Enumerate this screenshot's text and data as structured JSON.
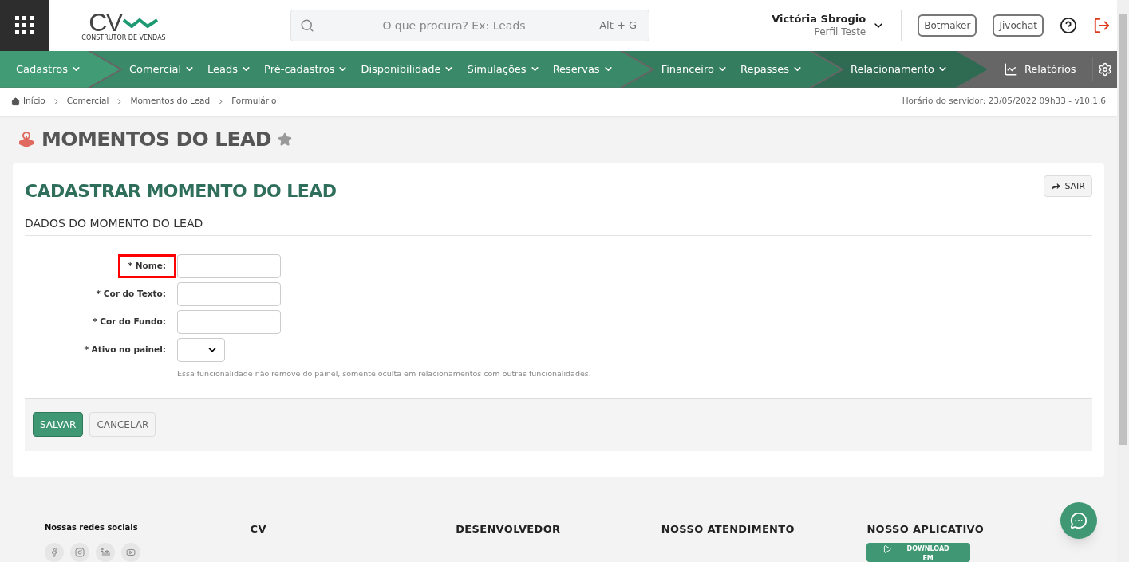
{
  "header": {
    "logo": {
      "mark": "CV",
      "tagline": "CONSTRUTOR DE VENDAS"
    },
    "search": {
      "placeholder": "O que procura? Ex: Leads",
      "shortcut": "Alt + G"
    },
    "user": {
      "name": "Victória Sbrogio",
      "profile": "Perfil Teste"
    },
    "buttons": [
      "Botmaker",
      "Jivochat"
    ]
  },
  "nav": {
    "groups": [
      {
        "items": [
          "Cadastros"
        ]
      },
      {
        "items": [
          "Comercial",
          "Leads",
          "Pré-cadastros",
          "Disponibilidade",
          "Simulações",
          "Reservas"
        ]
      },
      {
        "items": [
          "Financeiro",
          "Repasses"
        ]
      },
      {
        "items": [
          "Relacionamento"
        ]
      }
    ],
    "reports": "Relatórios"
  },
  "breadcrumb": {
    "items": [
      "Início",
      "Comercial",
      "Momentos do Lead",
      "Formulário"
    ],
    "server_time": "Horário do servidor: 23/05/2022 09h33 - v10.1.6"
  },
  "page": {
    "title": "MOMENTOS DO LEAD",
    "favorite": false
  },
  "card": {
    "title": "CADASTRAR MOMENTO DO LEAD",
    "exit_button": "SAIR",
    "section": "DADOS DO MOMENTO DO LEAD",
    "fields": [
      {
        "label": "* Nome:",
        "kind": "text",
        "highlighted": true
      },
      {
        "label": "* Cor do Texto:",
        "kind": "text",
        "highlighted": false
      },
      {
        "label": "* Cor do Fundo:",
        "kind": "text",
        "highlighted": false
      },
      {
        "label": "* Ativo no painel:",
        "kind": "select",
        "highlighted": false,
        "help": "Essa funcionalidade não remove do painel, somente oculta em relacionamentos com outras funcionalidades."
      }
    ],
    "save": "SALVAR",
    "cancel": "CANCELAR"
  },
  "footer": {
    "social_title": "Nossas redes sociais",
    "columns": [
      "CV",
      "DESENVOLVEDOR",
      "NOSSO ATENDIMENTO",
      "NOSSO APLICATIVO"
    ],
    "app_badge": "DOWNLOAD EM"
  }
}
